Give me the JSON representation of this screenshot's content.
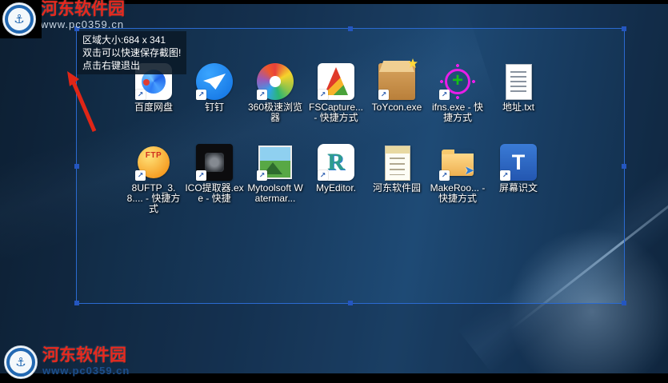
{
  "watermark": {
    "site_name": "河东软件园",
    "site_url": "www.pc0359.cn"
  },
  "capture": {
    "tooltip_line1": "区域大小:684 x 341",
    "tooltip_line2": "双击可以快速保存截图!",
    "tooltip_line3": "点击右键退出",
    "region_width": 684,
    "region_height": 341
  },
  "colors": {
    "selection_blue": "#2b6ad0",
    "arrow_red": "#e02617",
    "site_red": "#e8281e"
  },
  "desktop": {
    "icons": [
      {
        "label": "百度网盘"
      },
      {
        "label": "钉钉"
      },
      {
        "label": "360极速浏览器"
      },
      {
        "label": "FSCapture... - 快捷方式"
      },
      {
        "label": "ToYcon.exe"
      },
      {
        "label": "ifns.exe - 快捷方式"
      },
      {
        "label": "地址.txt"
      },
      {
        "label": "8UFTP_3.8.... - 快捷方式"
      },
      {
        "label": "ICO提取器.exe - 快捷"
      },
      {
        "label": "Mytoolsoft Watermar..."
      },
      {
        "label": "MyEditor."
      },
      {
        "label": "河东软件园"
      },
      {
        "label": "MakeRoo... - 快捷方式"
      },
      {
        "label": "屏幕识文"
      }
    ]
  }
}
